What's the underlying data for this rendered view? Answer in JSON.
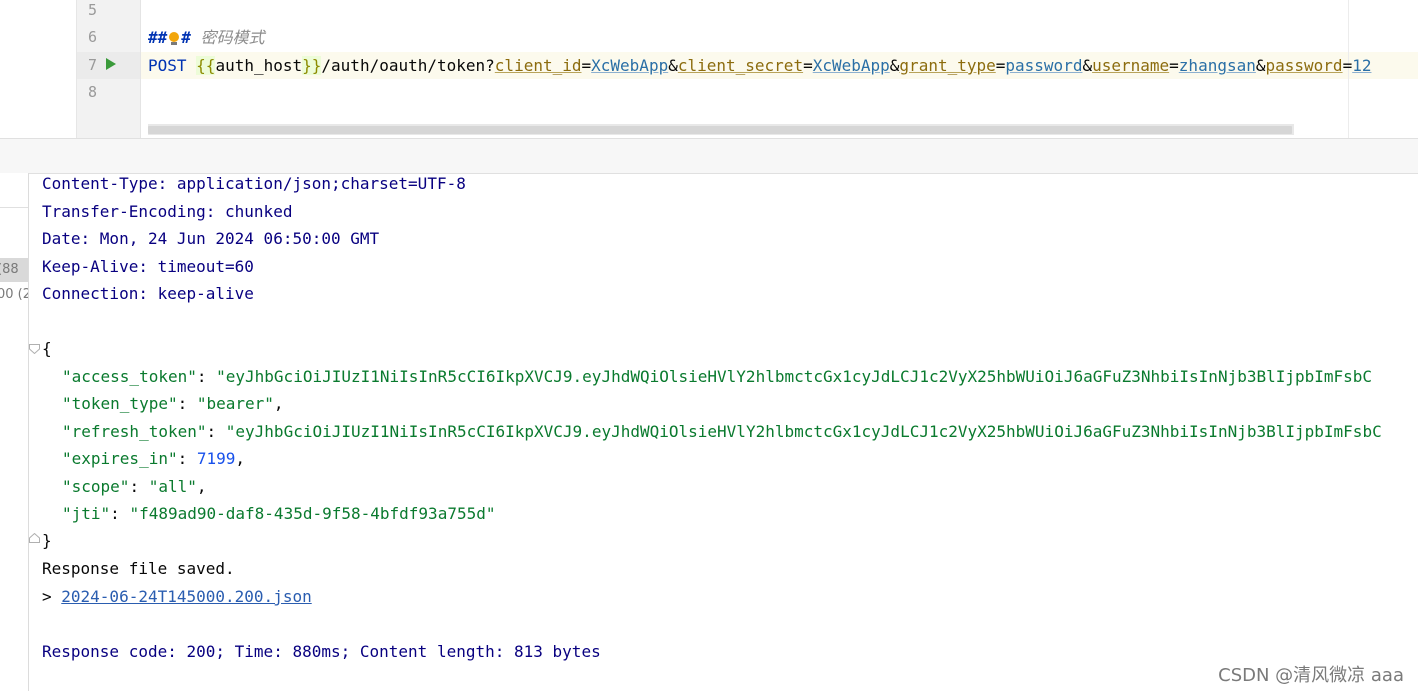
{
  "editor": {
    "line_numbers": [
      "5",
      "6",
      "7",
      "8"
    ],
    "comment_prefix_1": "#",
    "comment_prefix_2": "#",
    "comment_text": " 密码模式",
    "request": {
      "method": "POST",
      "brace_open": "{{",
      "host_var": "auth_host",
      "brace_close": "}}",
      "path": "/auth/oauth/token?",
      "params": [
        {
          "key": "client_id",
          "value": "XcWebApp"
        },
        {
          "key": "client_secret",
          "value": "XcWebApp"
        },
        {
          "key": "grant_type",
          "value": "password"
        },
        {
          "key": "username",
          "value": "zhangsan"
        },
        {
          "key": "password",
          "value": "12"
        }
      ]
    }
  },
  "history": {
    "items": [
      "(88",
      "00 (2"
    ]
  },
  "response": {
    "headers": [
      "Content-Type: application/json;charset=UTF-8",
      "Transfer-Encoding: chunked",
      "Date: Mon, 24 Jun 2024 06:50:00 GMT",
      "Keep-Alive: timeout=60",
      "Connection: keep-alive"
    ],
    "body": {
      "open": "{",
      "close": "}",
      "fields": [
        {
          "key": "\"access_token\"",
          "value": "\"eyJhbGciOiJIUzI1NiIsInR5cCI6IkpXVCJ9.eyJhdWQiOlsieHVlY2hlbmctcGx1cyJdLCJ1c2VyX25hbWUiOiJ6aGFuZ3NhbiIsInNjb3BlIjpbImFsbC",
          "type": "string",
          "comma": ""
        },
        {
          "key": "\"token_type\"",
          "value": "\"bearer\"",
          "type": "string",
          "comma": ","
        },
        {
          "key": "\"refresh_token\"",
          "value": "\"eyJhbGciOiJIUzI1NiIsInR5cCI6IkpXVCJ9.eyJhdWQiOlsieHVlY2hlbmctcGx1cyJdLCJ1c2VyX25hbWUiOiJ6aGFuZ3NhbiIsInNjb3BlIjpbImFsbC",
          "type": "string",
          "comma": ""
        },
        {
          "key": "\"expires_in\"",
          "value": "7199",
          "type": "number",
          "comma": ","
        },
        {
          "key": "\"scope\"",
          "value": "\"all\"",
          "type": "string",
          "comma": ","
        },
        {
          "key": "\"jti\"",
          "value": "\"f489ad90-daf8-435d-9f58-4bfdf93a755d\"",
          "type": "string",
          "comma": ""
        }
      ]
    },
    "saved_message": "Response file saved.",
    "file_prefix": "> ",
    "file_link": "2024-06-24T145000.200.json",
    "summary": "Response code: 200; Time: 880ms; Content length: 813 bytes"
  },
  "watermark": "CSDN @清风微凉 aaa",
  "colors": {
    "keyword": "#0033b3",
    "json_string": "#0a7a2e",
    "json_number": "#1750eb",
    "header_text": "#080080",
    "run_icon": "#3a9a3a"
  }
}
